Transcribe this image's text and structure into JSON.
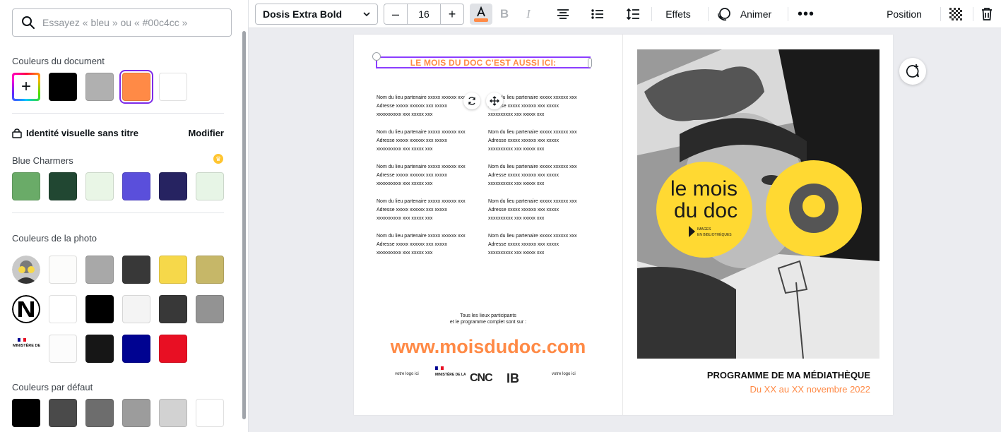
{
  "search": {
    "placeholder": "Essayez « bleu » ou « #00c4cc »"
  },
  "document_colors": {
    "title": "Couleurs du document",
    "swatches": [
      "#000000",
      "#b0b0b0",
      "#ff8a46",
      "#ffffff"
    ],
    "selected": "#ff8a46"
  },
  "brand": {
    "kit_name": "Identité visuelle sans titre",
    "edit_label": "Modifier",
    "palette_name": "Blue Charmers",
    "palette": [
      "#6aab68",
      "#214732",
      "#e9f6e6",
      "#5a4fdb",
      "#262361",
      "#e7f5e6"
    ]
  },
  "photo_colors": {
    "title": "Couleurs de la photo",
    "rows": [
      [
        "#fcfcfb",
        "#a8a8a8",
        "#383838",
        "#f6d84a",
        "#c6b768"
      ],
      [
        "#ffffff",
        "#000000",
        "#f4f4f4",
        "#383838",
        "#939393"
      ],
      [
        "#fcfcfc",
        "#161616",
        "#000391",
        "#e80f23"
      ]
    ],
    "thumb3_label": "MINISTÈRE DE LA CULTURE"
  },
  "default_colors": {
    "title": "Couleurs par défaut",
    "swatches": [
      "#000000",
      "#4a4a4a",
      "#6d6d6d",
      "#9c9c9c",
      "#d2d2d2",
      "#ffffff"
    ]
  },
  "toolbar": {
    "font": "Dosis Extra Bold",
    "size": "16",
    "effects": "Effets",
    "animate": "Animer",
    "position": "Position",
    "text_color": "#ff8a46"
  },
  "canvas": {
    "headline": "LE MOIS DU DOC C'EST AUSSI ICI:",
    "address_line1": "Nom du lieu partenaire xxxxx xxxxxx xxx",
    "address_line2": "Adresse xxxxx xxxxxx xxx xxxxx",
    "address_line3": "xxxxxxxxxx xxx xxxxx xxx",
    "footer_line1": "Tous les lieux participants",
    "footer_line2": "et le programme complet sont sur :",
    "url": "www.moisdudoc.com",
    "logo_placeholder": "votre logo ici",
    "ministere_label": "MINISTÈRE DE LA CULTURE",
    "cnc_label": "CNC",
    "ib_label": "IB",
    "badge_line1": "le mois",
    "badge_line2": "du doc",
    "badge_small1": "IMAGES",
    "badge_small2": "EN BIBLIOTHÈQUES",
    "program_title": "PROGRAMME DE MA MÉDIATHÈQUE",
    "program_date": "Du XX au XX novembre 2022",
    "accent_color": "#ff8a46",
    "yellow": "#ffd932"
  }
}
